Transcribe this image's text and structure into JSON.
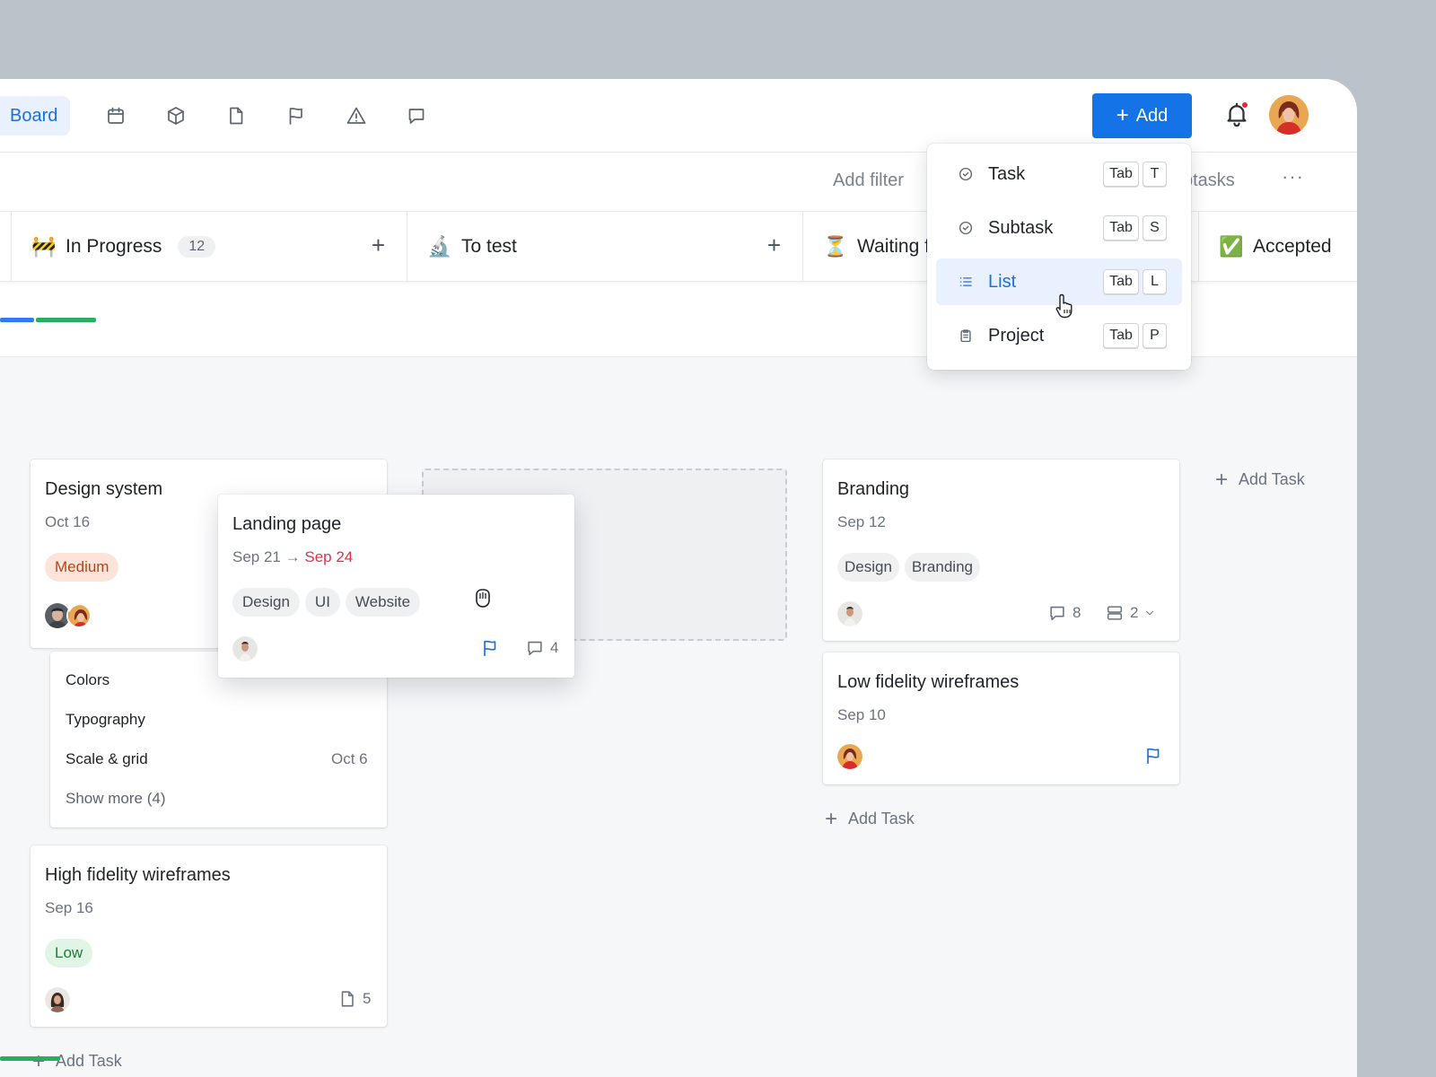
{
  "topbar": {
    "active_view": "Board",
    "view_icons": [
      "calendar-icon",
      "box-icon",
      "document-icon",
      "flag-icon",
      "warning-icon",
      "comment-icon"
    ],
    "add_button": "Add"
  },
  "filterbar": {
    "add_filter": "Add filter",
    "subtasks": "btasks",
    "more": "···"
  },
  "columns": [
    {
      "emoji": "🚧",
      "title": "In Progress",
      "count": "12"
    },
    {
      "emoji": "🔬",
      "title": "To test"
    },
    {
      "emoji": "⏳",
      "title": "Waiting f"
    },
    {
      "emoji": "✅",
      "title": "Accepted"
    }
  ],
  "cards": {
    "design_system": {
      "title": "Design system",
      "date": "Oct 16",
      "tag": "Medium"
    },
    "subtasks": {
      "items": [
        "Colors",
        "Typography",
        "Scale & grid"
      ],
      "last_date": "Oct 6",
      "show_more": "Show more (4)"
    },
    "high_fidelity": {
      "title": "High fidelity wireframes",
      "date": "Sep 16",
      "tag": "Low",
      "files": "5"
    },
    "landing_page": {
      "title": "Landing page",
      "date_start": "Sep 21",
      "arrow": "→",
      "date_end": "Sep 24",
      "tags": [
        "Design",
        "UI",
        "Website"
      ],
      "comments": "4"
    },
    "branding": {
      "title": "Branding",
      "date": "Sep 12",
      "tags": [
        "Design",
        "Branding"
      ],
      "comments": "8",
      "subtasks": "2"
    },
    "low_fidelity": {
      "title": "Low fidelity wireframes",
      "date": "Sep 10"
    }
  },
  "add_task_label": "Add Task",
  "add_menu": {
    "items": [
      {
        "label": "Task",
        "key1": "Tab",
        "key2": "T"
      },
      {
        "label": "Subtask",
        "key1": "Tab",
        "key2": "S"
      },
      {
        "label": "List",
        "key1": "Tab",
        "key2": "L"
      },
      {
        "label": "Project",
        "key1": "Tab",
        "key2": "P"
      }
    ],
    "active_item": "List"
  },
  "colors": {
    "accent": "#1473e6",
    "due_overdue": "#e0304a",
    "progress_blue": "#2f7cf0",
    "progress_green": "#27ae60"
  }
}
